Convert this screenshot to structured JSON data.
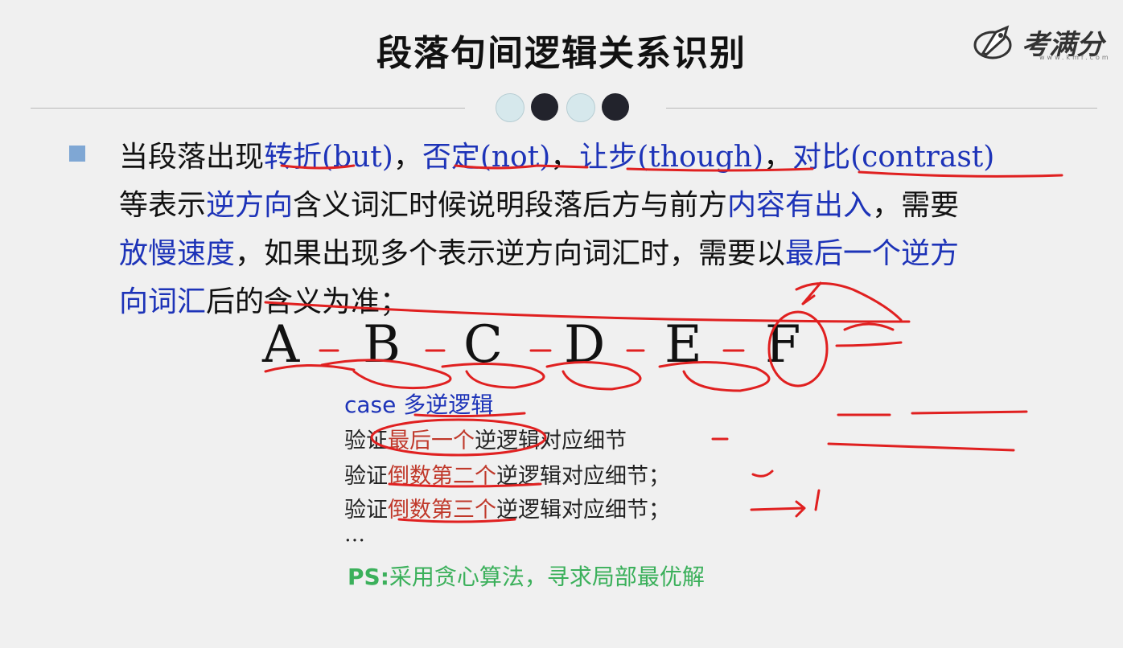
{
  "slide": {
    "title": "段落句间逻辑关系识别",
    "logo": {
      "text": "考满分",
      "subtext": "www.kmf.com"
    }
  },
  "paragraph": {
    "line1": [
      {
        "t": "当段落出现",
        "c": "black"
      },
      {
        "t": "转折(but)",
        "c": "blue"
      },
      {
        "t": "，",
        "c": "black"
      },
      {
        "t": "否定(not)",
        "c": "blue"
      },
      {
        "t": "，",
        "c": "black"
      },
      {
        "t": "让步(though)",
        "c": "blue"
      },
      {
        "t": "，",
        "c": "black"
      },
      {
        "t": "对比(contrast)",
        "c": "blue"
      }
    ],
    "line2": [
      {
        "t": "等表示",
        "c": "black"
      },
      {
        "t": "逆方向",
        "c": "blue"
      },
      {
        "t": "含义词汇时候说明段落后方与前方",
        "c": "black"
      },
      {
        "t": "内容有出入",
        "c": "blue"
      },
      {
        "t": "，需要",
        "c": "black"
      }
    ],
    "line3": [
      {
        "t": "放慢速度",
        "c": "blue"
      },
      {
        "t": "，如果出现多个表示逆方向词汇时，需要以",
        "c": "black"
      },
      {
        "t": "最后一个逆方",
        "c": "blue"
      }
    ],
    "line4": [
      {
        "t": "向词汇",
        "c": "blue"
      },
      {
        "t": "后的含义为准；",
        "c": "black"
      }
    ]
  },
  "letters": [
    "A",
    "B",
    "C",
    "D",
    "E",
    "F"
  ],
  "case": {
    "prefix": "case ",
    "label": "多逆逻辑"
  },
  "verify": [
    {
      "pre": "验证",
      "red": "最后一个",
      "post": "逆逻辑对应细节"
    },
    {
      "pre": "验证",
      "red": "倒数第二个",
      "post": "逆逻辑对应细节；"
    },
    {
      "pre": "验证",
      "red": "倒数第三个",
      "post": "逆逻辑对应细节；"
    }
  ],
  "ellipsis": "…",
  "ps": {
    "label": "PS:",
    "text": "采用贪心算法，寻求局部最优解"
  },
  "colors": {
    "blue": "#1d33b8",
    "red": "#c0392b",
    "green": "#3bb05b",
    "ink": "#e02020"
  }
}
